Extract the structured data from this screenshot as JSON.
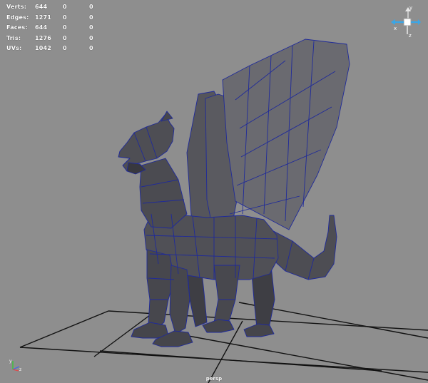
{
  "viewport": {
    "camera_name": "persp",
    "background_color": "#8e8e8e",
    "grid_color": "#000000",
    "mesh_color": "#4f4f55",
    "wireframe_color": "#1f2a9a"
  },
  "heads_up_display": {
    "rows": [
      {
        "label": "Verts:",
        "values": [
          "644",
          "0",
          "0"
        ]
      },
      {
        "label": "Edges:",
        "values": [
          "1271",
          "0",
          "0"
        ]
      },
      {
        "label": "Faces:",
        "values": [
          "644",
          "0",
          "0"
        ]
      },
      {
        "label": "Tris:",
        "values": [
          "1276",
          "0",
          "0"
        ]
      },
      {
        "label": "UVs:",
        "values": [
          "1042",
          "0",
          "0"
        ]
      }
    ]
  },
  "view_cube": {
    "icon": "view-cube-icon",
    "axis_labels": {
      "x": "x",
      "y": "y",
      "z": "z"
    }
  },
  "axis_indicator": {
    "icon": "axis-gizmo-icon",
    "axis_labels": {
      "y": "y",
      "z": "z"
    }
  }
}
